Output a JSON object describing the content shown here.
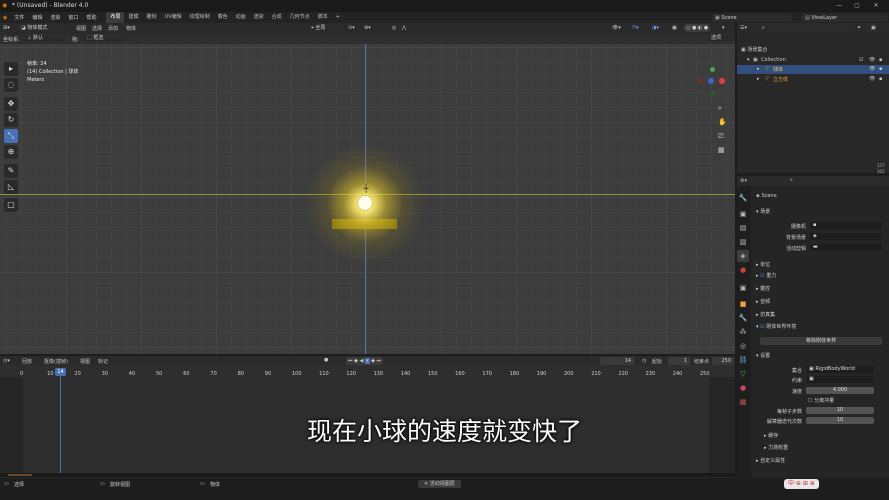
{
  "title_bar": {
    "title": "* (Unsaved) - Blender 4.0",
    "min": "—",
    "max": "▢",
    "close": "✕"
  },
  "menu": [
    "文件",
    "编辑",
    "渲染",
    "窗口",
    "帮助"
  ],
  "workspaces": [
    "布局",
    "建模",
    "雕刻",
    "UV编辑",
    "纹理绘制",
    "着色",
    "动画",
    "渲染",
    "合成",
    "几何节点",
    "脚本"
  ],
  "active_workspace": "布局",
  "scene": {
    "label": "Scene",
    "viewlayer": "ViewLayer"
  },
  "viewport_header": {
    "mode": "物体模式",
    "menus": [
      "视图",
      "选择",
      "添加",
      "物体"
    ],
    "transform": "全局",
    "options": "选项"
  },
  "toolbar2": {
    "coord": "坐标系:",
    "coord_val": "默认",
    "drag": "拖:",
    "select": "框选"
  },
  "viewport_info": {
    "line1": "帧率: 24",
    "line2": "(14) Collection | 球体",
    "line3": "Meters"
  },
  "outliner": {
    "root": "场景集合",
    "collection": "Collection",
    "items": [
      "球体",
      "立方体"
    ]
  },
  "side_numbers": [
    "337",
    "302"
  ],
  "properties": {
    "scene_name": "Scene",
    "sections": {
      "scene": "场景",
      "camera": "摄像机",
      "bg_scene": "背景场景",
      "active_clip": "活动剪辑",
      "units": "单位",
      "gravity": "重力",
      "keying": "键控",
      "audio": "音频",
      "simulation": "仿真集",
      "rigid_body": "刚体世界环境",
      "remove_rigid": "移除刚体世界",
      "settings": "设置",
      "collection": "集合",
      "collection_val": "RigidBodyWorld",
      "constraints": "约束",
      "speed": "速度",
      "speed_val": "4.000",
      "split": "分离冲量",
      "substeps": "每帧子步数",
      "substeps_val": "10",
      "solver": "解算器迭代次数",
      "solver_val": "10",
      "cache": "缓存",
      "field_weights": "力场权重",
      "custom": "自定义属性"
    }
  },
  "timeline": {
    "menus": [
      "回放",
      "抠像(插帧)",
      "视图",
      "标记"
    ],
    "current_frame": "14",
    "start_label": "起始",
    "start": "1",
    "end_label": "结束点",
    "end": "250",
    "ticks": [
      "0",
      "10",
      "20",
      "30",
      "40",
      "50",
      "60",
      "70",
      "80",
      "90",
      "100",
      "110",
      "120",
      "130",
      "140",
      "150",
      "160",
      "170",
      "180",
      "190",
      "200",
      "210",
      "220",
      "230",
      "240",
      "250"
    ]
  },
  "status": {
    "select": "选择",
    "pan": "旋转视图",
    "object": "物体",
    "right": "活动视图层"
  },
  "subtitle": "现在小球的速度就变快了",
  "watermark": "中·⊕ ⊞ ⊕",
  "colors": {
    "accent": "#4772b3",
    "glow": "#fff8b0",
    "cube": "#8c7d10",
    "playhead": "#4772b3"
  }
}
